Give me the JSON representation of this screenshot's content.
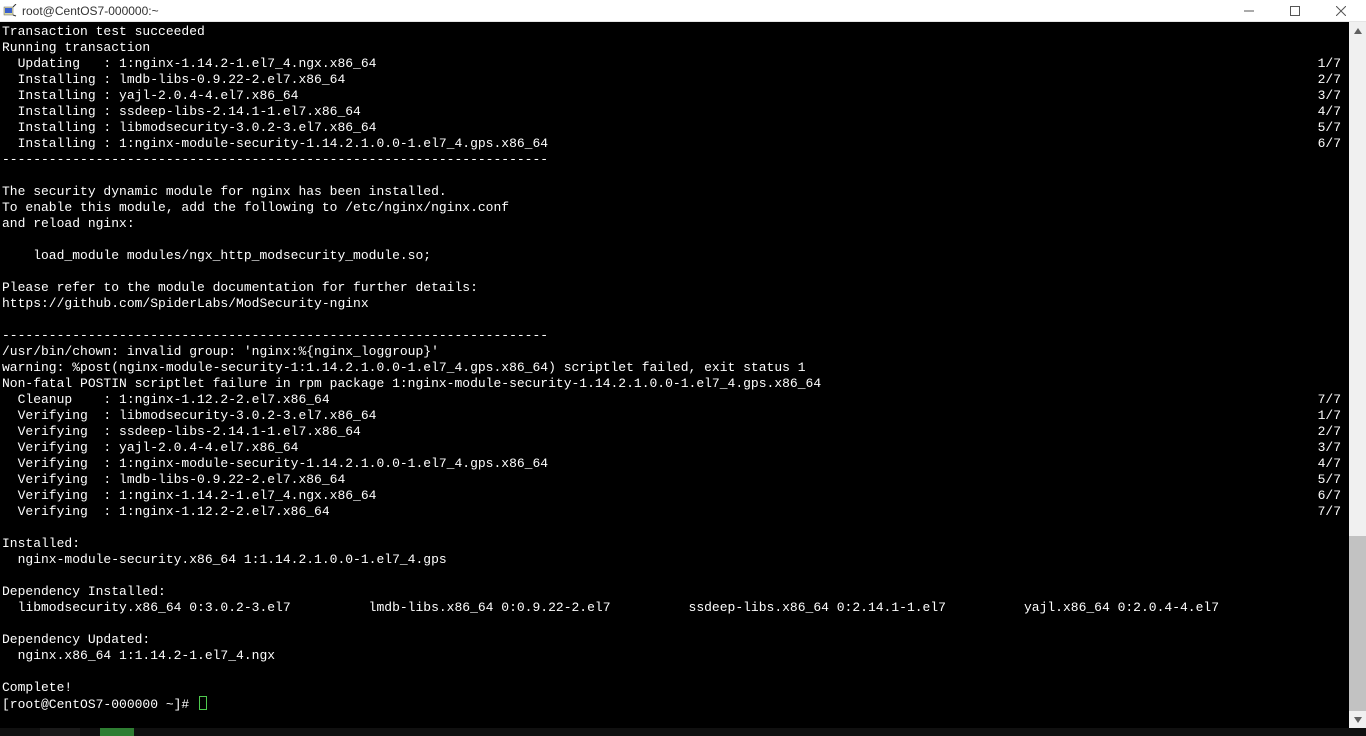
{
  "titlebar": {
    "title": "root@CentOS7-000000:~"
  },
  "terminal": {
    "pre": [
      "Transaction test succeeded",
      "Running transaction"
    ],
    "ops": [
      {
        "l": "  Updating   : 1:nginx-1.14.2-1.el7_4.ngx.x86_64",
        "r": "1/7"
      },
      {
        "l": "  Installing : lmdb-libs-0.9.22-2.el7.x86_64",
        "r": "2/7"
      },
      {
        "l": "  Installing : yajl-2.0.4-4.el7.x86_64",
        "r": "3/7"
      },
      {
        "l": "  Installing : ssdeep-libs-2.14.1-1.el7.x86_64",
        "r": "4/7"
      },
      {
        "l": "  Installing : libmodsecurity-3.0.2-3.el7.x86_64",
        "r": "5/7"
      },
      {
        "l": "  Installing : 1:nginx-module-security-1.14.2.1.0.0-1.el7_4.gps.x86_64",
        "r": "6/7"
      }
    ],
    "mid": [
      "----------------------------------------------------------------------",
      "",
      "The security dynamic module for nginx has been installed.",
      "To enable this module, add the following to /etc/nginx/nginx.conf",
      "and reload nginx:",
      "",
      "    load_module modules/ngx_http_modsecurity_module.so;",
      "",
      "Please refer to the module documentation for further details:",
      "https://github.com/SpiderLabs/ModSecurity-nginx",
      "",
      "----------------------------------------------------------------------",
      "/usr/bin/chown: invalid group: 'nginx:%{nginx_loggroup}'",
      "warning: %post(nginx-module-security-1:1.14.2.1.0.0-1.el7_4.gps.x86_64) scriptlet failed, exit status 1",
      "Non-fatal POSTIN scriptlet failure in rpm package 1:nginx-module-security-1.14.2.1.0.0-1.el7_4.gps.x86_64"
    ],
    "ops2": [
      {
        "l": "  Cleanup    : 1:nginx-1.12.2-2.el7.x86_64",
        "r": "7/7"
      },
      {
        "l": "  Verifying  : libmodsecurity-3.0.2-3.el7.x86_64",
        "r": "1/7"
      },
      {
        "l": "  Verifying  : ssdeep-libs-2.14.1-1.el7.x86_64",
        "r": "2/7"
      },
      {
        "l": "  Verifying  : yajl-2.0.4-4.el7.x86_64",
        "r": "3/7"
      },
      {
        "l": "  Verifying  : 1:nginx-module-security-1.14.2.1.0.0-1.el7_4.gps.x86_64",
        "r": "4/7"
      },
      {
        "l": "  Verifying  : lmdb-libs-0.9.22-2.el7.x86_64",
        "r": "5/7"
      },
      {
        "l": "  Verifying  : 1:nginx-1.14.2-1.el7_4.ngx.x86_64",
        "r": "6/7"
      },
      {
        "l": "  Verifying  : 1:nginx-1.12.2-2.el7.x86_64",
        "r": "7/7"
      }
    ],
    "post": [
      "",
      "Installed:",
      "  nginx-module-security.x86_64 1:1.14.2.1.0.0-1.el7_4.gps",
      "",
      "Dependency Installed:",
      "  libmodsecurity.x86_64 0:3.0.2-3.el7          lmdb-libs.x86_64 0:0.9.22-2.el7          ssdeep-libs.x86_64 0:2.14.1-1.el7          yajl.x86_64 0:2.0.4-4.el7",
      "",
      "Dependency Updated:",
      "  nginx.x86_64 1:1.14.2-1.el7_4.ngx",
      "",
      "Complete!"
    ],
    "prompt": "[root@CentOS7-000000 ~]# "
  }
}
